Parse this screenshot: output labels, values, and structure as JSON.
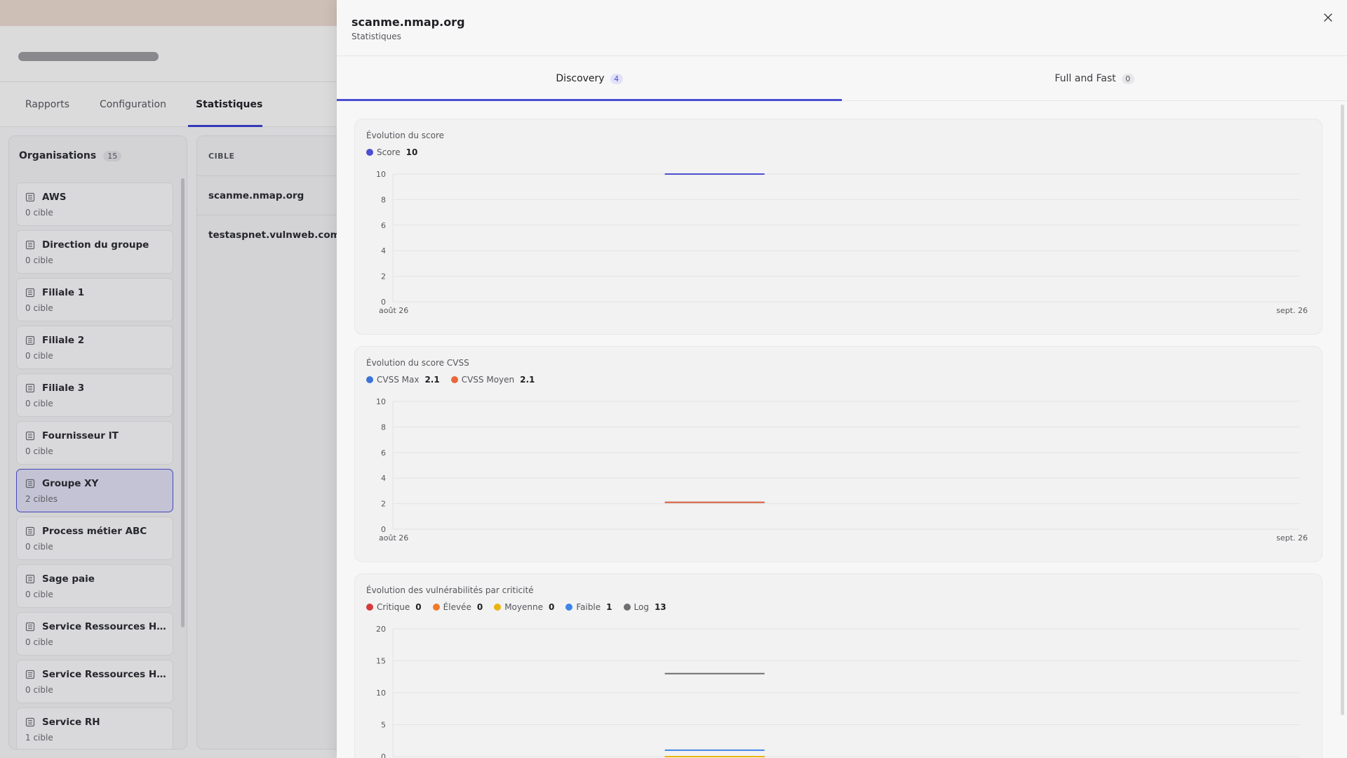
{
  "background": {
    "tabs": [
      {
        "label": "Rapports"
      },
      {
        "label": "Configuration"
      },
      {
        "label": "Statistiques"
      }
    ],
    "organizations": {
      "title": "Organisations",
      "count": "15",
      "items": [
        {
          "name": "AWS",
          "count": "0 cible"
        },
        {
          "name": "Direction du groupe",
          "count": "0 cible"
        },
        {
          "name": "Filiale 1",
          "count": "0 cible"
        },
        {
          "name": "Filiale 2",
          "count": "0 cible"
        },
        {
          "name": "Filiale 3",
          "count": "0 cible"
        },
        {
          "name": "Fournisseur IT",
          "count": "0 cible"
        },
        {
          "name": "Groupe XY",
          "count": "2 cibles",
          "selected": true
        },
        {
          "name": "Process métier ABC",
          "count": "0 cible"
        },
        {
          "name": "Sage paie",
          "count": "0 cible"
        },
        {
          "name": "Service Ressources Hu...",
          "count": "0 cible"
        },
        {
          "name": "Service Ressources Hu...",
          "count": "0 cible"
        },
        {
          "name": "Service RH",
          "count": "1 cible"
        }
      ]
    },
    "targets": {
      "header": "CIBLE",
      "items": [
        "scanme.nmap.org",
        "testaspnet.vulnweb.com"
      ]
    }
  },
  "drawer": {
    "title": "scanme.nmap.org",
    "subtitle": "Statistiques",
    "tabs": [
      {
        "label": "Discovery",
        "count": "4",
        "active": true
      },
      {
        "label": "Full and Fast",
        "count": "0",
        "active": false
      }
    ]
  },
  "chart_data": [
    {
      "type": "line",
      "title": "Évolution du score",
      "x_start": "août 26",
      "x_end": "sept. 26",
      "yticks": [
        0,
        2,
        4,
        6,
        8,
        10
      ],
      "ylim": [
        0,
        10
      ],
      "legend_placement": "top-left",
      "grid": true,
      "segment": [
        0.3,
        0.41
      ],
      "series": [
        {
          "name": "Score",
          "value_label": "10",
          "value": 10,
          "color": "#4b4fd1"
        }
      ]
    },
    {
      "type": "line",
      "title": "Évolution du score CVSS",
      "x_start": "août 26",
      "x_end": "sept. 26",
      "yticks": [
        0,
        2,
        4,
        6,
        8,
        10
      ],
      "ylim": [
        0,
        10
      ],
      "legend_placement": "top-left",
      "grid": true,
      "segment": [
        0.3,
        0.41
      ],
      "series": [
        {
          "name": "CVSS Max",
          "value_label": "2.1",
          "value": 2.1,
          "color": "#3b73d9"
        },
        {
          "name": "CVSS Moyen",
          "value_label": "2.1",
          "value": 2.1,
          "color": "#e8683a"
        }
      ]
    },
    {
      "type": "line",
      "title": "Évolution des vulnérabilités par criticité",
      "x_start": "août 26",
      "x_end": "sept. 26",
      "yticks": [
        0,
        5,
        10,
        15,
        20
      ],
      "ylim": [
        0,
        20
      ],
      "legend_placement": "top-left",
      "grid": true,
      "segment": [
        0.3,
        0.41
      ],
      "series": [
        {
          "name": "Critique",
          "value_label": "0",
          "value": 0,
          "color": "#d63a3a"
        },
        {
          "name": "Élevée",
          "value_label": "0",
          "value": 0,
          "color": "#ee7a2a"
        },
        {
          "name": "Moyenne",
          "value_label": "0",
          "value": 0,
          "color": "#e8b410"
        },
        {
          "name": "Faible",
          "value_label": "1",
          "value": 1,
          "color": "#3f85e8"
        },
        {
          "name": "Log",
          "value_label": "13",
          "value": 13,
          "color": "#6e6e72"
        }
      ]
    }
  ]
}
